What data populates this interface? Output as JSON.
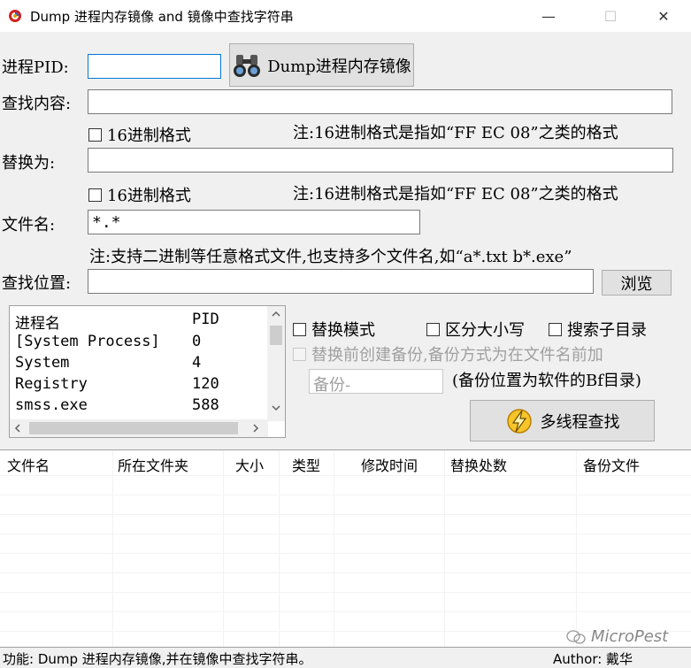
{
  "window": {
    "title": "Dump 进程内存镜像 and 镜像中查找字符串",
    "minimize": "—",
    "maximize": "☐",
    "close": "✕"
  },
  "pid": {
    "label": "进程PID:",
    "value": ""
  },
  "dump_button": {
    "label": "Dump进程内存镜像"
  },
  "search": {
    "label": "查找内容:",
    "value": "",
    "hex_label": "16进制格式",
    "hex_note": "注:16进制格式是指如“FF EC 08”之类的格式"
  },
  "replace": {
    "label": "替换为:",
    "value": "",
    "hex_label": "16进制格式",
    "hex_note": "注:16进制格式是指如“FF EC 08”之类的格式"
  },
  "filename": {
    "label": "文件名:",
    "value": "*.*",
    "note": "注:支持二进制等任意格式文件,也支持多个文件名,如“a*.txt b*.exe”"
  },
  "location": {
    "label": "查找位置:",
    "value": "",
    "browse": "浏览"
  },
  "process_list": {
    "headers": [
      "进程名",
      "PID"
    ],
    "rows": [
      {
        "name": "[System Process]",
        "pid": "0"
      },
      {
        "name": "System",
        "pid": "4"
      },
      {
        "name": "Registry",
        "pid": "120"
      },
      {
        "name": "smss.exe",
        "pid": "588"
      }
    ]
  },
  "options": {
    "replace_mode": "替换模式",
    "case_sensitive": "区分大小写",
    "search_subdirs": "搜索子目录",
    "backup": "替换前创建备份,备份方式为在文件名前加",
    "backup_prefix": "备份-",
    "backup_note": "(备份位置为软件的Bf目录)"
  },
  "search_button": {
    "label": "多线程查找"
  },
  "results": {
    "columns": [
      "文件名",
      "所在文件夹",
      "大小",
      "类型",
      "修改时间",
      "替换处数",
      "备份文件"
    ]
  },
  "status": {
    "left": "功能: Dump 进程内存镜像,并在镜像中查找字符串。",
    "right": "Author: 戴华"
  },
  "watermark": {
    "text": "MicroPest"
  }
}
